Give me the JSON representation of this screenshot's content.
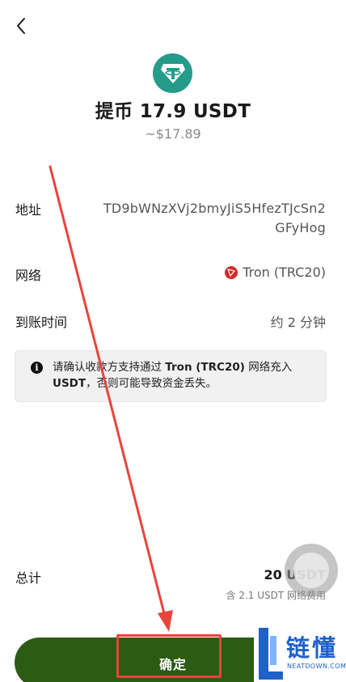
{
  "header": {
    "back_icon": "chevron-left-icon",
    "coin_icon": "tether-usdt-icon",
    "title": "提币 17.9 USDT",
    "fiat_value": "~$17.89"
  },
  "details": {
    "address_label": "地址",
    "address_value": "TD9bWNzXVj2bmyJiS5HfezTJcSn2GFyHog",
    "network_label": "网络",
    "network_icon": "tron-icon",
    "network_value": "Tron (TRC20)",
    "arrival_label": "到账时间",
    "arrival_value": "约 2 分钟"
  },
  "notice": {
    "icon": "info-icon",
    "text_1": "请确认收款方支持通过 ",
    "bold_1": "Tron (TRC20)",
    "text_2": " 网络充入 ",
    "bold_2": "USDT",
    "text_3": "，否则可能导致资金丢失。"
  },
  "summary": {
    "total_label": "总计",
    "total_value": "20 USDT",
    "fee_note": "含 2.1 USDT 网络费用"
  },
  "actions": {
    "confirm_label": "确定"
  },
  "watermark": {
    "text": "链懂",
    "subtext": "NEATDOWN.COM"
  },
  "colors": {
    "accent_green": "#2c5b14",
    "tether_teal": "#259c8a",
    "tron_red": "#d42a27",
    "annotation_red": "#e8443c",
    "watermark_blue": "#1f61c9"
  }
}
